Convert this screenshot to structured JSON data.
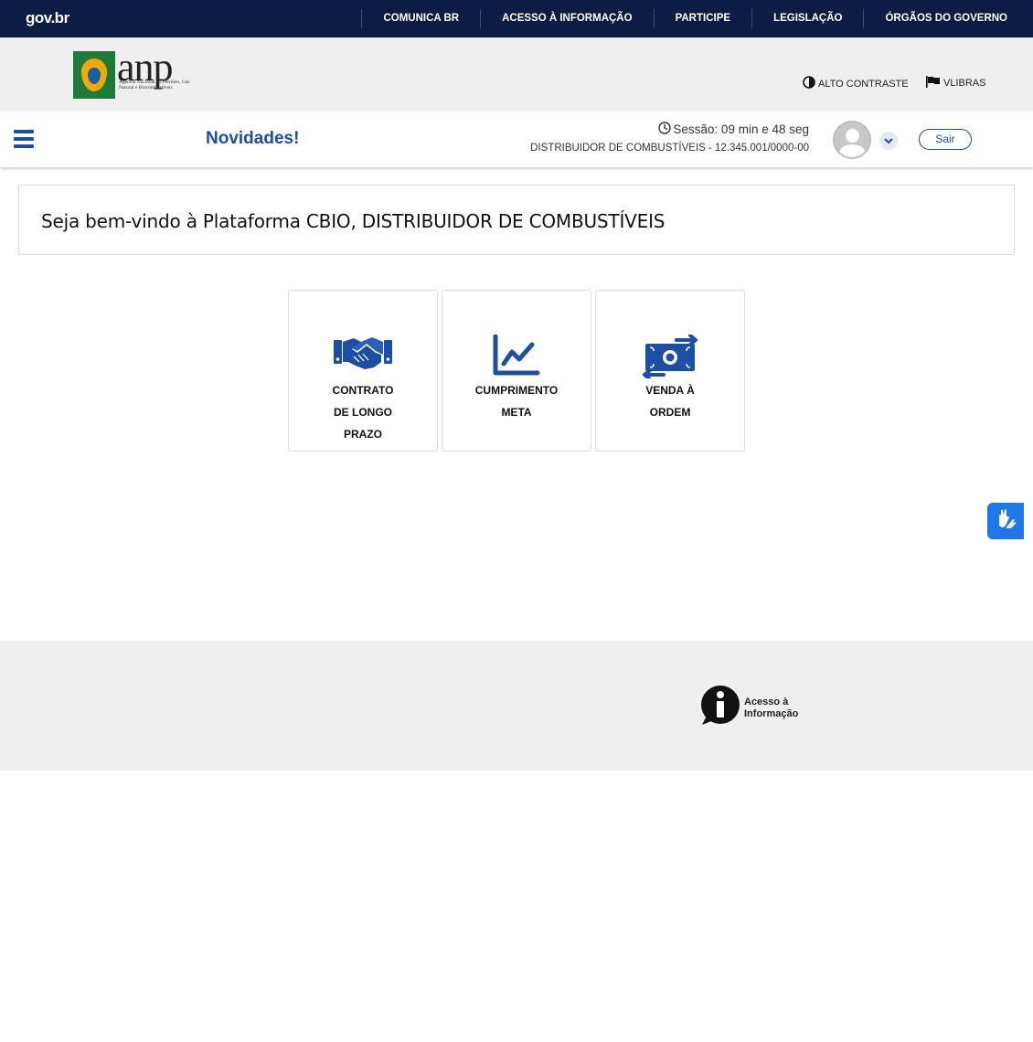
{
  "govbar": {
    "logo": "gov.br",
    "links": [
      "COMUNICA BR",
      "ACESSO À INFORMAÇÃO",
      "PARTICIPE",
      "LEGISLAÇÃO",
      "ÓRGÃOS DO GOVERNO"
    ],
    "bg_color": "#0c1d45"
  },
  "anp": {
    "logo_word": "anp",
    "logo_sub": "Agência Nacional do Petróleo, Gás Natural e Biocombustíveis",
    "alto_contraste": "ALTO CONTRASTE",
    "vlibras": "VLIBRAS"
  },
  "navbar": {
    "novidades": "Novidades!",
    "session": "Sessão: 09 min e 48 seg",
    "company": "DISTRIBUIDOR DE COMBUSTÍVEIS - 12.345.001/0000-00",
    "sair": "Sair",
    "accent_color": "#1c4ea3"
  },
  "welcome": {
    "title": "Seja bem-vindo à Plataforma CBIO, DISTRIBUIDOR DE COMBUSTÍVEIS"
  },
  "tiles": [
    {
      "icon": "handshake-icon",
      "lines": [
        "CONTRATO",
        "DE LONGO",
        "PRAZO"
      ]
    },
    {
      "icon": "line-chart-icon",
      "lines": [
        "CUMPRIMENTO",
        "META"
      ]
    },
    {
      "icon": "money-exchange-icon",
      "lines": [
        "VENDA À",
        "ORDEM"
      ]
    }
  ],
  "footer": {
    "info_line1": "Acesso à",
    "info_line2": "Informação"
  }
}
